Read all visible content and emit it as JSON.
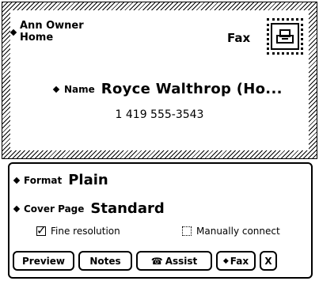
{
  "sender": {
    "name": "Ann Owner",
    "location": "Home"
  },
  "envelope": {
    "fax_label": "Fax",
    "stamp_icon": "fax-stamp-icon"
  },
  "recipient": {
    "name_label": "Name",
    "name_value": "Royce Walthrop (Ho...",
    "phone": "1 419 555-3543"
  },
  "form": {
    "format_label": "Format",
    "format_value": "Plain",
    "cover_label": "Cover Page",
    "cover_value": "Standard",
    "fine_resolution": {
      "label": "Fine resolution",
      "checked": true
    },
    "manually_connect": {
      "label": "Manually connect",
      "checked": false
    }
  },
  "buttons": {
    "preview": "Preview",
    "notes": "Notes",
    "assist": "Assist",
    "fax": "Fax",
    "close": "X"
  }
}
